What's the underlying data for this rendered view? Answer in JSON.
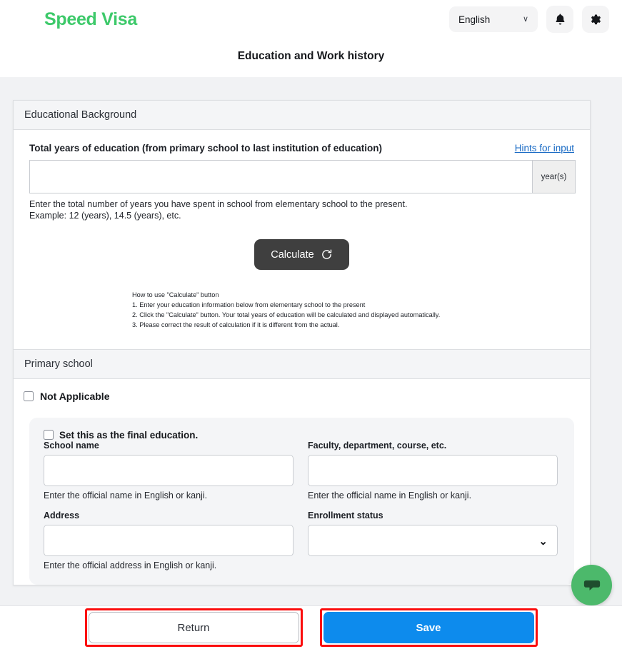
{
  "header": {
    "brand": "Speed Visa",
    "language_value": "English",
    "chevron": "∨",
    "notifications_icon": "bell-icon",
    "settings_icon": "gear-icon",
    "page_title": "Education and Work history"
  },
  "educational_background": {
    "section_title": "Educational Background",
    "total_years_label": "Total years of education (from primary school to last institution of education)",
    "hints_link": "Hints for input",
    "total_years_value": "",
    "total_years_placeholder": "",
    "unit_suffix": "year(s)",
    "help_line1": "Enter the total number of years you have spent in school from elementary school to the present.",
    "help_line2": "Example: 12 (years), 14.5 (years), etc.",
    "calculate_label": "Calculate",
    "calculate_icon": "refresh-icon",
    "howto_title": "How to use \"Calculate\" button",
    "howto_step1": "1. Enter your education information below from elementary school to the present",
    "howto_step2": "2. Click the \"Calculate\" button. Your total years of education will be calculated and displayed automatically.",
    "howto_step3": "3. Please correct the result of calculation if it is different from the actual."
  },
  "primary_school": {
    "section_title": "Primary school",
    "not_applicable_label": "Not Applicable",
    "final_education_label": "Set this as the final education.",
    "school_name_label": "School name",
    "school_name_value": "",
    "school_name_note": "Enter the official name in English or kanji.",
    "faculty_label": "Faculty, department, course, etc.",
    "faculty_value": "",
    "faculty_note": "Enter the official name in English or kanji.",
    "address_label": "Address",
    "address_value": "",
    "address_note": "Enter the official address in English or kanji.",
    "enrollment_label": "Enrollment status",
    "enrollment_value": "",
    "enrollment_chevron": "⌄"
  },
  "footer": {
    "return_label": "Return",
    "save_label": "Save"
  },
  "chat": {
    "icon": "chat-bubble-icon"
  },
  "colors": {
    "brand_green": "#3dc96a",
    "link_blue": "#1769c4",
    "save_blue": "#0d8bed",
    "calculate_dark": "#3f3f3f",
    "highlight_red": "#fb0d0d",
    "chat_green": "#4cb96b",
    "page_bg": "#f1f2f4"
  }
}
